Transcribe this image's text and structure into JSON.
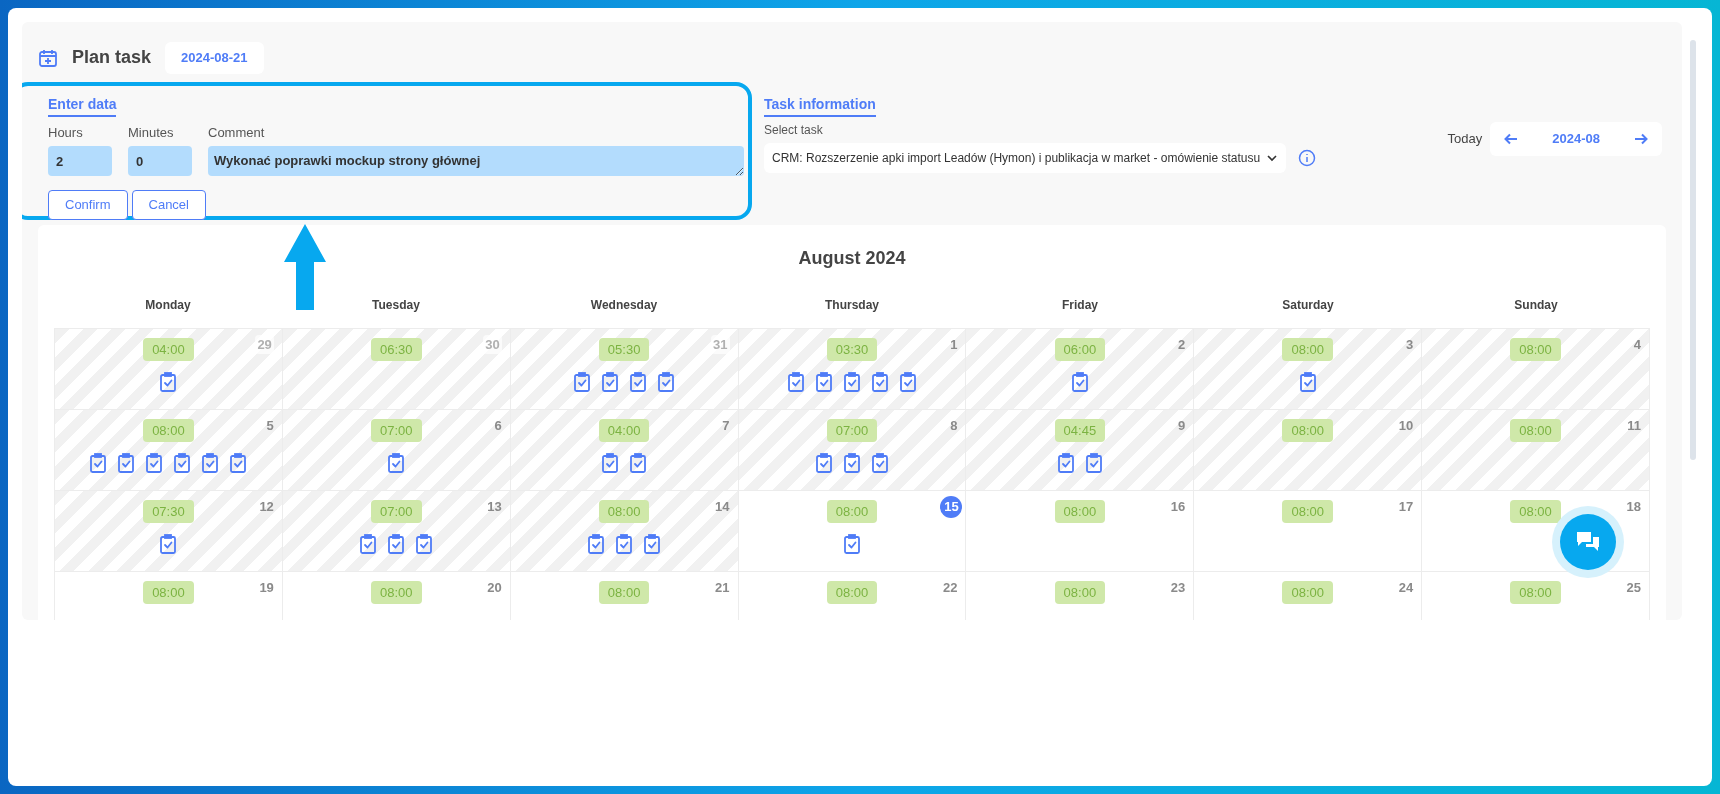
{
  "header": {
    "title": "Plan task",
    "date": "2024-08-21"
  },
  "enter_data": {
    "title": "Enter data",
    "hours": {
      "label": "Hours",
      "value": "2"
    },
    "minutes": {
      "label": "Minutes",
      "value": "0"
    },
    "comment": {
      "label": "Comment",
      "value": "Wykonać poprawki mockup strony głównej"
    },
    "buttons": [
      "Confirm",
      "Cancel"
    ]
  },
  "task_information": {
    "title": "Task information",
    "select_label": "Select task",
    "selected_task": "CRM: Rozszerzenie apki import Leadów (Hymon) i publikacja w market - omówienie statusu"
  },
  "month_nav": {
    "today": "Today",
    "month": "2024-08"
  },
  "calendar": {
    "title": "August 2024",
    "weekdays": [
      "Monday",
      "Tuesday",
      "Wednesday",
      "Thursday",
      "Friday",
      "Saturday",
      "Sunday"
    ],
    "weeks": [
      [
        {
          "day": "29",
          "hours": "04:00",
          "past": true,
          "other_month": true,
          "today": false,
          "tasks": [
            {
              "kind": "clipboard"
            }
          ]
        },
        {
          "day": "30",
          "hours": "06:30",
          "past": true,
          "other_month": true,
          "today": false
        },
        {
          "day": "31",
          "hours": "05:30",
          "past": true,
          "other_month": true,
          "today": false,
          "tasks": [
            {
              "kind": "clipboard"
            },
            {
              "kind": "clipboard"
            },
            {
              "kind": "clipboard"
            },
            {
              "kind": "clipboard"
            }
          ]
        },
        {
          "day": "1",
          "hours": "03:30",
          "past": true,
          "other_month": false,
          "today": false,
          "tasks": [
            {
              "kind": "clipboard"
            },
            {
              "kind": "clipboard"
            },
            {
              "kind": "clipboard"
            },
            {
              "kind": "clipboard"
            },
            {
              "kind": "clipboard"
            }
          ]
        },
        {
          "day": "2",
          "hours": "06:00",
          "past": true,
          "other_month": false,
          "today": false,
          "tasks": [
            {
              "kind": "clipboard"
            }
          ]
        },
        {
          "day": "3",
          "hours": "08:00",
          "past": true,
          "other_month": false,
          "today": false,
          "tasks": [
            {
              "kind": "clipboard"
            }
          ]
        },
        {
          "day": "4",
          "hours": "08:00",
          "past": true,
          "other_month": false,
          "today": false
        }
      ],
      [
        {
          "day": "5",
          "hours": "08:00",
          "past": true,
          "other_month": false,
          "today": false,
          "tasks": [
            {
              "kind": "clipboard"
            },
            {
              "kind": "clipboard"
            },
            {
              "kind": "clipboard"
            },
            {
              "kind": "clipboard"
            },
            {
              "kind": "clipboard"
            },
            {
              "kind": "clipboard"
            }
          ]
        },
        {
          "day": "6",
          "hours": "07:00",
          "past": true,
          "other_month": false,
          "today": false,
          "tasks": [
            {
              "kind": "clipboard"
            }
          ]
        },
        {
          "day": "7",
          "hours": "04:00",
          "past": true,
          "other_month": false,
          "today": false,
          "tasks": [
            {
              "kind": "clipboard"
            },
            {
              "kind": "clipboard"
            }
          ]
        },
        {
          "day": "8",
          "hours": "07:00",
          "past": true,
          "other_month": false,
          "today": false,
          "tasks": [
            {
              "kind": "clipboard"
            },
            {
              "kind": "clipboard"
            },
            {
              "kind": "clipboard"
            }
          ]
        },
        {
          "day": "9",
          "hours": "04:45",
          "past": true,
          "other_month": false,
          "today": false,
          "tasks": [
            {
              "kind": "clipboard"
            },
            {
              "kind": "clipboard"
            }
          ]
        },
        {
          "day": "10",
          "hours": "08:00",
          "past": true,
          "other_month": false,
          "today": false
        },
        {
          "day": "11",
          "hours": "08:00",
          "past": true,
          "other_month": false,
          "today": false
        }
      ],
      [
        {
          "day": "12",
          "hours": "07:30",
          "past": true,
          "other_month": false,
          "today": false,
          "tasks": [
            {
              "kind": "clipboard"
            }
          ]
        },
        {
          "day": "13",
          "hours": "07:00",
          "past": true,
          "other_month": false,
          "today": false,
          "tasks": [
            {
              "kind": "clipboard"
            },
            {
              "kind": "clipboard"
            },
            {
              "kind": "clipboard"
            }
          ]
        },
        {
          "day": "14",
          "hours": "08:00",
          "past": true,
          "other_month": false,
          "today": false,
          "tasks": [
            {
              "kind": "clipboard"
            },
            {
              "kind": "clipboard"
            },
            {
              "kind": "clipboard"
            }
          ]
        },
        {
          "day": "15",
          "hours": "08:00",
          "past": false,
          "other_month": false,
          "today": true,
          "tasks": [
            {
              "kind": "clipboard"
            }
          ]
        },
        {
          "day": "16",
          "hours": "08:00",
          "past": false,
          "other_month": false,
          "today": false
        },
        {
          "day": "17",
          "hours": "08:00",
          "past": false,
          "other_month": false,
          "today": false
        },
        {
          "day": "18",
          "hours": "08:00",
          "past": false,
          "other_month": false,
          "today": false
        }
      ],
      [
        {
          "day": "19",
          "hours": "08:00",
          "past": false,
          "other_month": false,
          "today": false
        },
        {
          "day": "20",
          "hours": "08:00",
          "past": false,
          "other_month": false,
          "today": false
        },
        {
          "day": "21",
          "hours": "08:00",
          "past": false,
          "other_month": false,
          "today": false
        },
        {
          "day": "22",
          "hours": "08:00",
          "past": false,
          "other_month": false,
          "today": false
        },
        {
          "day": "23",
          "hours": "08:00",
          "past": false,
          "other_month": false,
          "today": false
        },
        {
          "day": "24",
          "hours": "08:00",
          "past": false,
          "other_month": false,
          "today": false
        },
        {
          "day": "25",
          "hours": "08:00",
          "past": false,
          "other_month": false,
          "today": false
        }
      ]
    ]
  }
}
